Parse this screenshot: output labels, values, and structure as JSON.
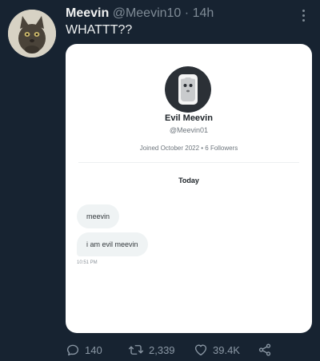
{
  "tweet": {
    "display_name": "Meevin",
    "handle": "@Meevin10",
    "separator": "·",
    "time": "14h",
    "text": "WHATTT??"
  },
  "card": {
    "profile_name": "Evil Meevin",
    "profile_handle": "@Meevin01",
    "profile_meta": "Joined October 2022 • 6 Followers",
    "date_divider": "Today",
    "messages": [
      {
        "text": "meevin"
      },
      {
        "text": "i am evil meevin"
      }
    ],
    "message_time": "10:51 PM"
  },
  "actions": {
    "replies": "140",
    "retweets": "2,339",
    "likes": "39.4K"
  },
  "icons": {
    "reply": "reply-icon",
    "retweet": "retweet-icon",
    "like": "heart-icon",
    "share": "share-icon",
    "more": "more-icon"
  }
}
